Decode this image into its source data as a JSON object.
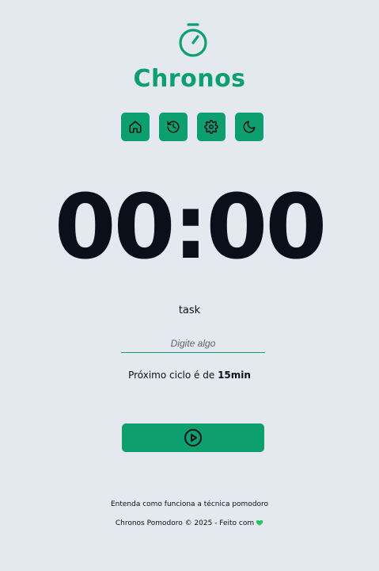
{
  "app": {
    "name": "Chronos",
    "brand_color": "#0e9f6e",
    "logo_icon": "stopwatch-icon"
  },
  "nav": {
    "items": [
      {
        "icon": "house-icon",
        "label": "home"
      },
      {
        "icon": "history-icon",
        "label": "history"
      },
      {
        "icon": "gear-icon",
        "label": "settings"
      },
      {
        "icon": "moon-icon",
        "label": "theme"
      }
    ]
  },
  "timer": {
    "display": "00:00"
  },
  "task": {
    "label": "task",
    "value": "",
    "placeholder": "Digite algo"
  },
  "cycle": {
    "text": "Próximo ciclo é de ",
    "duration": "15min"
  },
  "controls": {
    "play_icon": "play-circle-icon"
  },
  "footer": {
    "link_text": "Entenda como funciona a técnica pomodoro",
    "copyright": "Chronos Pomodoro © 2025 - Feito com",
    "heart_icon": "heart-icon",
    "heart_color": "#22c55e"
  }
}
